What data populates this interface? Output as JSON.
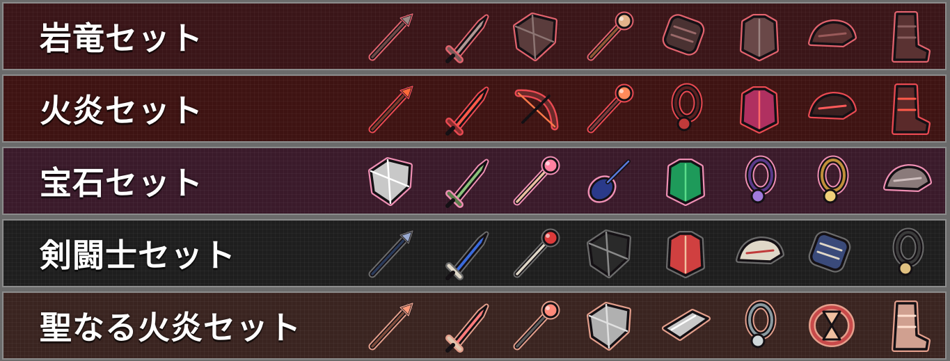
{
  "sets": [
    {
      "title": "岩竜セット",
      "bg": "#3a1518",
      "outline": "#e2636e",
      "items": [
        {
          "icon": "spear-icon",
          "fill": "#6b4a48",
          "accent": "#9d8a86"
        },
        {
          "icon": "sword-icon",
          "fill": "#7a5a58",
          "accent": "#b09894"
        },
        {
          "icon": "shield-icon",
          "fill": "#5a3c3c",
          "accent": "#8d7573"
        },
        {
          "icon": "staff-icon",
          "fill": "#8d5a35",
          "accent": "#e3b38a"
        },
        {
          "icon": "gauntlet-icon",
          "fill": "#4a3232",
          "accent": "#9a6a6a"
        },
        {
          "icon": "armor-icon",
          "fill": "#6a4848",
          "accent": "#9c8482"
        },
        {
          "icon": "helmet-icon",
          "fill": "#5a3030",
          "accent": "#9a5a5a"
        },
        {
          "icon": "boots-icon",
          "fill": "#5a3232",
          "accent": "#8c6060"
        }
      ]
    },
    {
      "title": "火炎セット",
      "bg": "#3e1312",
      "outline": "#ea4a52",
      "items": [
        {
          "icon": "flame-spear-icon",
          "fill": "#7a3a2a",
          "accent": "#ff6a3a"
        },
        {
          "icon": "flame-sword-icon",
          "fill": "#8a2e2e",
          "accent": "#ff5a4a"
        },
        {
          "icon": "flame-bow-icon",
          "fill": "#6a2a2a",
          "accent": "#ff7a4a"
        },
        {
          "icon": "flame-staff-icon",
          "fill": "#7a3a3a",
          "accent": "#ff8a5a"
        },
        {
          "icon": "ring-icon",
          "fill": "#5a2020",
          "accent": "#c03a3a"
        },
        {
          "icon": "flame-armor-icon",
          "fill": "#b03060",
          "accent": "#ff6a6a"
        },
        {
          "icon": "flame-helmet-icon",
          "fill": "#3a2020",
          "accent": "#ff5a5a"
        },
        {
          "icon": "flame-boots-icon",
          "fill": "#5a2a2a",
          "accent": "#ff5a4a"
        }
      ]
    },
    {
      "title": "宝石セット",
      "bg": "#3a1a2a",
      "outline": "#ef8fb4",
      "items": [
        {
          "icon": "crystal-shield-icon",
          "fill": "#c8c8c8",
          "accent": "#ffffff"
        },
        {
          "icon": "rapier-icon",
          "fill": "#5a7a4a",
          "accent": "#8ac07a"
        },
        {
          "icon": "gem-wand-icon",
          "fill": "#e8c0a0",
          "accent": "#ff80a0"
        },
        {
          "icon": "violin-icon",
          "fill": "#2a3a8a",
          "accent": "#5a7adc"
        },
        {
          "icon": "emerald-armor-icon",
          "fill": "#1e9a5a",
          "accent": "#5adc8a"
        },
        {
          "icon": "amethyst-ring-icon",
          "fill": "#5a3a8a",
          "accent": "#a07adc"
        },
        {
          "icon": "gold-necklace-icon",
          "fill": "#c0903a",
          "accent": "#f0d07a"
        },
        {
          "icon": "tiara-icon",
          "fill": "#8a7a7a",
          "accent": "#d0c0c0"
        }
      ]
    },
    {
      "title": "剣闘士セット",
      "bg": "#1e1e1e",
      "outline": "#6c6c6c",
      "items": [
        {
          "icon": "javelin-icon",
          "fill": "#2a3a5a",
          "accent": "#9aaad0"
        },
        {
          "icon": "scimitar-icon",
          "fill": "#e0d8c8",
          "accent": "#3a6adc"
        },
        {
          "icon": "mace-icon",
          "fill": "#e0d8c8",
          "accent": "#dc3a3a"
        },
        {
          "icon": "spiked-shield-icon",
          "fill": "#2a2a2a",
          "accent": "#8a8a8a"
        },
        {
          "icon": "gladiator-armor-icon",
          "fill": "#d04040",
          "accent": "#f0c0a0"
        },
        {
          "icon": "gladiator-helmet-icon",
          "fill": "#e0d8c8",
          "accent": "#c03a3a"
        },
        {
          "icon": "cestus-icon",
          "fill": "#3a4a7a",
          "accent": "#e0d8c8"
        },
        {
          "icon": "amulet-icon",
          "fill": "#3a3a3a",
          "accent": "#e0c080"
        }
      ]
    },
    {
      "title": "聖なる火炎セット",
      "bg": "#3a2420",
      "outline": "#e49f8c",
      "items": [
        {
          "icon": "holy-spear-icon",
          "fill": "#7a4a3a",
          "accent": "#ff9a7a"
        },
        {
          "icon": "holy-sword-icon",
          "fill": "#e0c8b0",
          "accent": "#ff7a7a"
        },
        {
          "icon": "holy-hammer-icon",
          "fill": "#5a5a5a",
          "accent": "#ff8a7a"
        },
        {
          "icon": "round-shield-icon",
          "fill": "#b0b0b0",
          "accent": "#e0e0e0"
        },
        {
          "icon": "scroll-icon",
          "fill": "#c8c8c8",
          "accent": "#ffffff"
        },
        {
          "icon": "rope-ring-icon",
          "fill": "#8a9aa0",
          "accent": "#d0d8da"
        },
        {
          "icon": "hourglass-icon",
          "fill": "#c84a4a",
          "accent": "#f0c0a0"
        },
        {
          "icon": "holy-boots-icon",
          "fill": "#d0a090",
          "accent": "#ffe0d0"
        }
      ]
    }
  ]
}
